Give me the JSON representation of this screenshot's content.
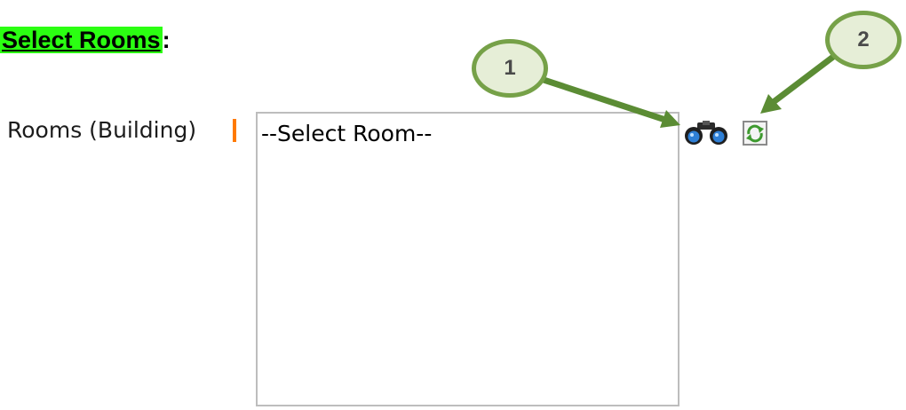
{
  "heading": {
    "title": "Select Rooms",
    "suffix": ":"
  },
  "rooms_field": {
    "label": "Rooms (Building)",
    "selected_option": "--Select Room--"
  },
  "callouts": {
    "first": "1",
    "second": "2"
  },
  "colors": {
    "heading_highlight": "#2bff12",
    "required_marker": "#ff7a00",
    "callout_border": "#76a148",
    "callout_fill": "#e6eed7",
    "arrow": "#5b8c34"
  },
  "icons": {
    "search": "binoculars-icon",
    "refresh": "refresh-icon"
  }
}
